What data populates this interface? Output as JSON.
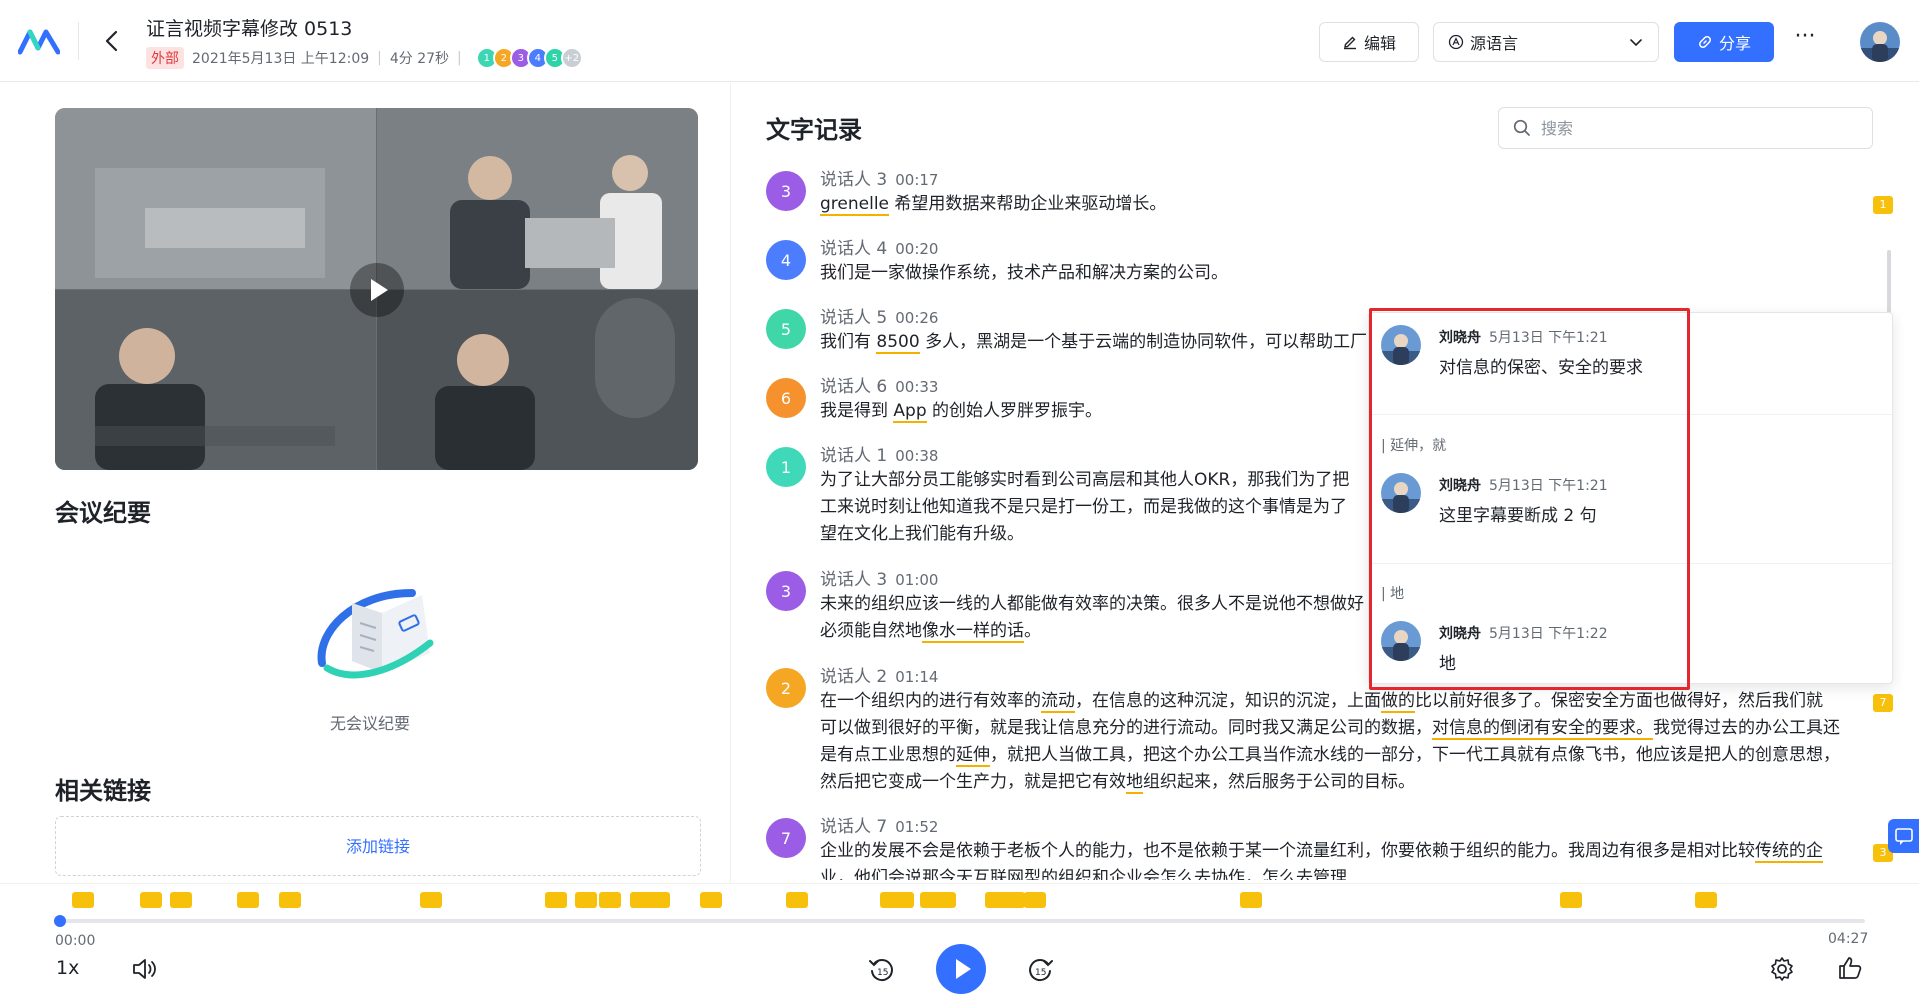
{
  "header": {
    "title": "证言视频字幕修改 0513",
    "badge": "外部",
    "date": "2021年5月13日 上午12:09",
    "duration": "4分 27秒",
    "participants": [
      {
        "label": "1",
        "color": "#3dd6b5"
      },
      {
        "label": "2",
        "color": "#f5a623"
      },
      {
        "label": "3",
        "color": "#9b5de5"
      },
      {
        "label": "4",
        "color": "#4c7dff"
      },
      {
        "label": "5",
        "color": "#2dd4a8"
      },
      {
        "label": "+2",
        "color": "#c9cdd4"
      }
    ],
    "edit_label": "编辑",
    "lang_label": "源语言",
    "share_label": "分享",
    "more_label": "···"
  },
  "left": {
    "summary_title": "会议纪要",
    "summary_empty": "无会议纪要",
    "links_title": "相关链接",
    "add_link": "添加链接"
  },
  "transcript": {
    "title": "文字记录",
    "search_placeholder": "搜索",
    "segments": [
      {
        "num": "3",
        "color": "#9b5de5",
        "speaker": "说话人 3",
        "time": "00:17"
      },
      {
        "num": "4",
        "color": "#4c7dff",
        "speaker": "说话人 4",
        "time": "00:20",
        "text": "我们是一家做操作系统，技术产品和解决方案的公司。"
      },
      {
        "num": "5",
        "color": "#3fd6a8",
        "speaker": "说话人 5",
        "time": "00:26"
      },
      {
        "num": "6",
        "color": "#f5922e",
        "speaker": "说话人 6",
        "time": "00:33"
      },
      {
        "num": "1",
        "color": "#3fd8b8",
        "speaker": "说话人 1",
        "time": "00:38"
      },
      {
        "num": "3",
        "color": "#9b5de5",
        "speaker": "说话人 3",
        "time": "01:00"
      },
      {
        "num": "2",
        "color": "#f5a623",
        "speaker": "说话人 2",
        "time": "01:14"
      },
      {
        "num": "7",
        "color": "#9b5de5",
        "speaker": "说话人 7",
        "time": "01:52"
      }
    ],
    "parts": {
      "s1_a": "grenelle",
      "s1_b": " 希望用数据来帮助企业来驱动增长。",
      "s3_a": "我们有 ",
      "s3_b": "8500",
      "s3_c": " 多人，黑湖是一个基于云端的制造协同软件，可以帮助工厂",
      "s4_a": "我是得到 ",
      "s4_b": "App",
      "s4_c": " 的创始人罗胖罗振宇。",
      "s5_l1": "为了让大部分员工能够实时看到公司高层和其他人OKR，那我们为了把",
      "s5_l2": "工来说时刻让他知道我不是只是打一份工，而是我做的这个事情是为了",
      "s5_l3": "望在文化上我们能有升级。",
      "s6_l1": "未来的组织应该一线的人都能做有效率的决策。很多人不是说他不想做好",
      "s6_l2a": "必须能自然地",
      "s6_l2b": "像水一样的话",
      "s6_l2c": "。",
      "s7_l1a": "在一个组织内的进行有效率的",
      "s7_l1b": "流动",
      "s7_l1c": "，在信息的这种沉淀，知识的沉淀，上面",
      "s7_l1d": "做的",
      "s7_l1e": "比以前好很多了。保密安全方面也做得好，然后我们就",
      "s7_l2a": "可以做到很好的平衡，就是我让信息充分的进行流动。同时我又满足公司的数据，",
      "s7_l2b": "对信息的倒闭有安全的要求。",
      "s7_l2c": "我觉得过去的办公工具还",
      "s7_l3a": "是有点工业思想的",
      "s7_l3b": "延伸",
      "s7_l3c": "，就把人当做工具，把这个办公工具当作流水线的一部分，下一代工具就有点像飞书，他应该是把人的创意思想，",
      "s7_l4a": "然后把它变成一个生产力，就是把它有效",
      "s7_l4b": "地",
      "s7_l4c": "组织起来，然后服务于公司的目标。",
      "s8_l1a": "企业的发展不会是依赖于老板个人的能力，也不是依赖于某一个流量红利，你要依赖于组织的能力。我周边有很多是相对比较",
      "s8_l1b": "传统的企",
      "s8_l2": "业，他们会说那今天互联网型的组织和企业会怎么去协作，怎么去管理"
    }
  },
  "comments": [
    {
      "name": "刘晓舟",
      "date": "5月13日 下午1:21",
      "body": "对信息的保密、安全的要求"
    },
    {
      "quote": "| 延伸，就",
      "name": "刘晓舟",
      "date": "5月13日 下午1:21",
      "body": "这里字幕要断成 2 句"
    },
    {
      "quote": "| 地",
      "name": "刘晓舟",
      "date": "5月13日 下午1:22",
      "body": "地"
    }
  ],
  "markers": {
    "m1": "1",
    "m2": "7",
    "m3": "3"
  },
  "player": {
    "current": "00:00",
    "total": "04:27",
    "speed": "1x",
    "progress": 0
  },
  "colors": {
    "accent": "#3370ff",
    "highlight": "#f5b100",
    "comment_marker": "#f7c10b",
    "frame": "#e3272d"
  }
}
